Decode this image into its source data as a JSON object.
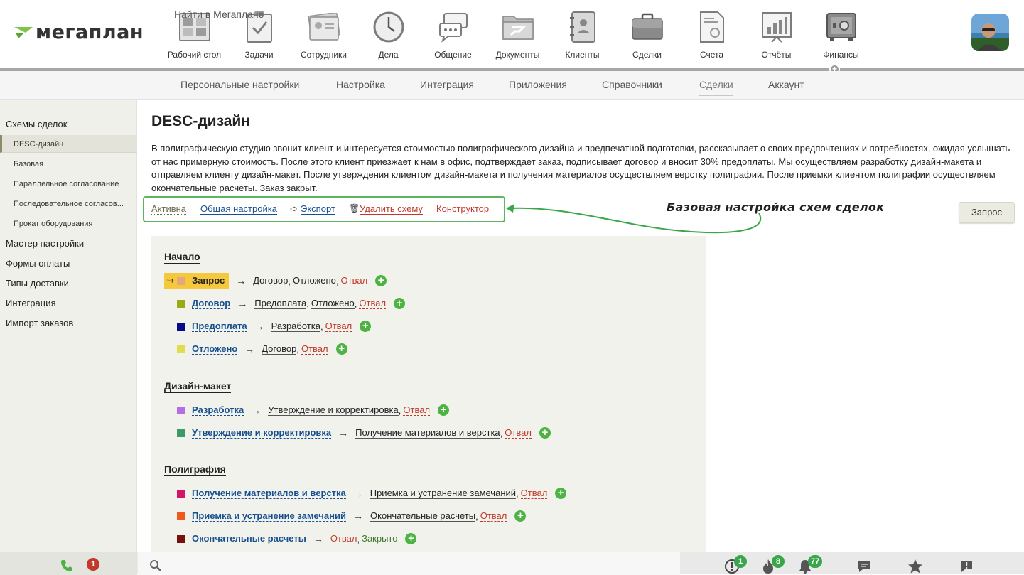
{
  "brand": {
    "name": "мегаплан"
  },
  "nav": [
    {
      "label": "Рабочий стол",
      "icon": "desktop-icon"
    },
    {
      "label": "Задачи",
      "icon": "tasks-icon"
    },
    {
      "label": "Сотрудники",
      "icon": "employees-icon"
    },
    {
      "label": "Дела",
      "icon": "clock-icon"
    },
    {
      "label": "Общение",
      "icon": "chat-icon"
    },
    {
      "label": "Документы",
      "icon": "folder-icon"
    },
    {
      "label": "Клиенты",
      "icon": "contacts-book-icon"
    },
    {
      "label": "Сделки",
      "icon": "briefcase-icon"
    },
    {
      "label": "Счета",
      "icon": "invoice-icon"
    },
    {
      "label": "Отчёты",
      "icon": "reports-icon"
    },
    {
      "label": "Финансы",
      "icon": "safe-icon"
    }
  ],
  "subnav": [
    "Персональные настройки",
    "Настройка",
    "Интеграция",
    "Приложения",
    "Справочники",
    "Сделки",
    "Аккаунт"
  ],
  "subnav_active": "Сделки",
  "sidebar": {
    "schemes_title": "Схемы сделок",
    "schemes": [
      "DESC-дизайн",
      "Базовая",
      "Параллельное согласование",
      "Последовательное согласов...",
      "Прокат оборудования"
    ],
    "active_scheme": "DESC-дизайн",
    "sections": [
      "Мастер настройки",
      "Формы оплаты",
      "Типы доставки",
      "Интеграция",
      "Импорт заказов"
    ]
  },
  "main": {
    "title": "DESC-дизайн",
    "description": "В полиграфическую студию звонит клиент и интересуется стоимостью полиграфического дизайна и предпечатной подготовки, рассказывает о своих предпочтениях и потребностях, ожидая услышать от нас примерную стоимость. После этого клиент приезжает к нам в офис, подтверждает заказ, подписывает договор и вносит 30% предоплаты. Мы осуществляем разработку дизайн-макета и отправляем клиенту дизайн-макет. После утверждения клиентом дизайн-макета и получения материалов осуществляем верстку полиграфии. После приемки клиентом полиграфии осуществляем окончательные расчеты. Заказ закрыт.",
    "actions": {
      "active": "Активна",
      "general": "Общая настройка",
      "export": "Экспорт",
      "delete": "Удалить схему",
      "constructor": "Конструктор"
    },
    "annotation": "Базовая настройка схем сделок",
    "request_button": "Запрос"
  },
  "scheme": [
    {
      "title": "Начало",
      "states": [
        {
          "name": "Запрос",
          "color": "#e8a77a",
          "initial": true,
          "transitions": [
            {
              "t": "Договор",
              "k": "normal"
            },
            {
              "t": "Отложено",
              "k": "normal"
            },
            {
              "t": "Отвал",
              "k": "fail"
            }
          ]
        },
        {
          "name": "Договор",
          "color": "#9aaa14",
          "transitions": [
            {
              "t": "Предоплата",
              "k": "normal"
            },
            {
              "t": "Отложено",
              "k": "normal"
            },
            {
              "t": "Отвал",
              "k": "fail"
            }
          ]
        },
        {
          "name": "Предоплата",
          "color": "#0a0a8c",
          "transitions": [
            {
              "t": "Разработка",
              "k": "normal"
            },
            {
              "t": "Отвал",
              "k": "fail"
            }
          ]
        },
        {
          "name": "Отложено",
          "color": "#e1dc4c",
          "transitions": [
            {
              "t": "Договор",
              "k": "normal"
            },
            {
              "t": "Отвал",
              "k": "fail"
            }
          ]
        }
      ]
    },
    {
      "title": "Дизайн-макет",
      "states": [
        {
          "name": "Разработка",
          "color": "#b56ee8",
          "transitions": [
            {
              "t": "Утверждение и корректировка",
              "k": "normal"
            },
            {
              "t": "Отвал",
              "k": "fail"
            }
          ]
        },
        {
          "name": "Утверждение и корректировка",
          "color": "#3c9a66",
          "transitions": [
            {
              "t": "Получение материалов и верстка",
              "k": "normal"
            },
            {
              "t": "Отвал",
              "k": "fail"
            }
          ]
        }
      ]
    },
    {
      "title": "Полиграфия",
      "states": [
        {
          "name": "Получение материалов и верстка",
          "color": "#d21567",
          "transitions": [
            {
              "t": "Приемка и устранение замечаний",
              "k": "normal"
            },
            {
              "t": "Отвал",
              "k": "fail"
            }
          ]
        },
        {
          "name": "Приемка и устранение замечаний",
          "color": "#f0581d",
          "transitions": [
            {
              "t": "Окончательные расчеты",
              "k": "normal"
            },
            {
              "t": "Отвал",
              "k": "fail"
            }
          ]
        },
        {
          "name": "Окончательные расчеты",
          "color": "#7a0e0e",
          "transitions": [
            {
              "t": "Отвал",
              "k": "fail"
            },
            {
              "t": "Закрыто",
              "k": "success"
            }
          ]
        }
      ]
    }
  ],
  "bottom": {
    "call_count": "1",
    "search_placeholder": "Найти в Мегаплане",
    "alerts_count": "1",
    "hot_count": "8",
    "notifications_count": "77"
  }
}
